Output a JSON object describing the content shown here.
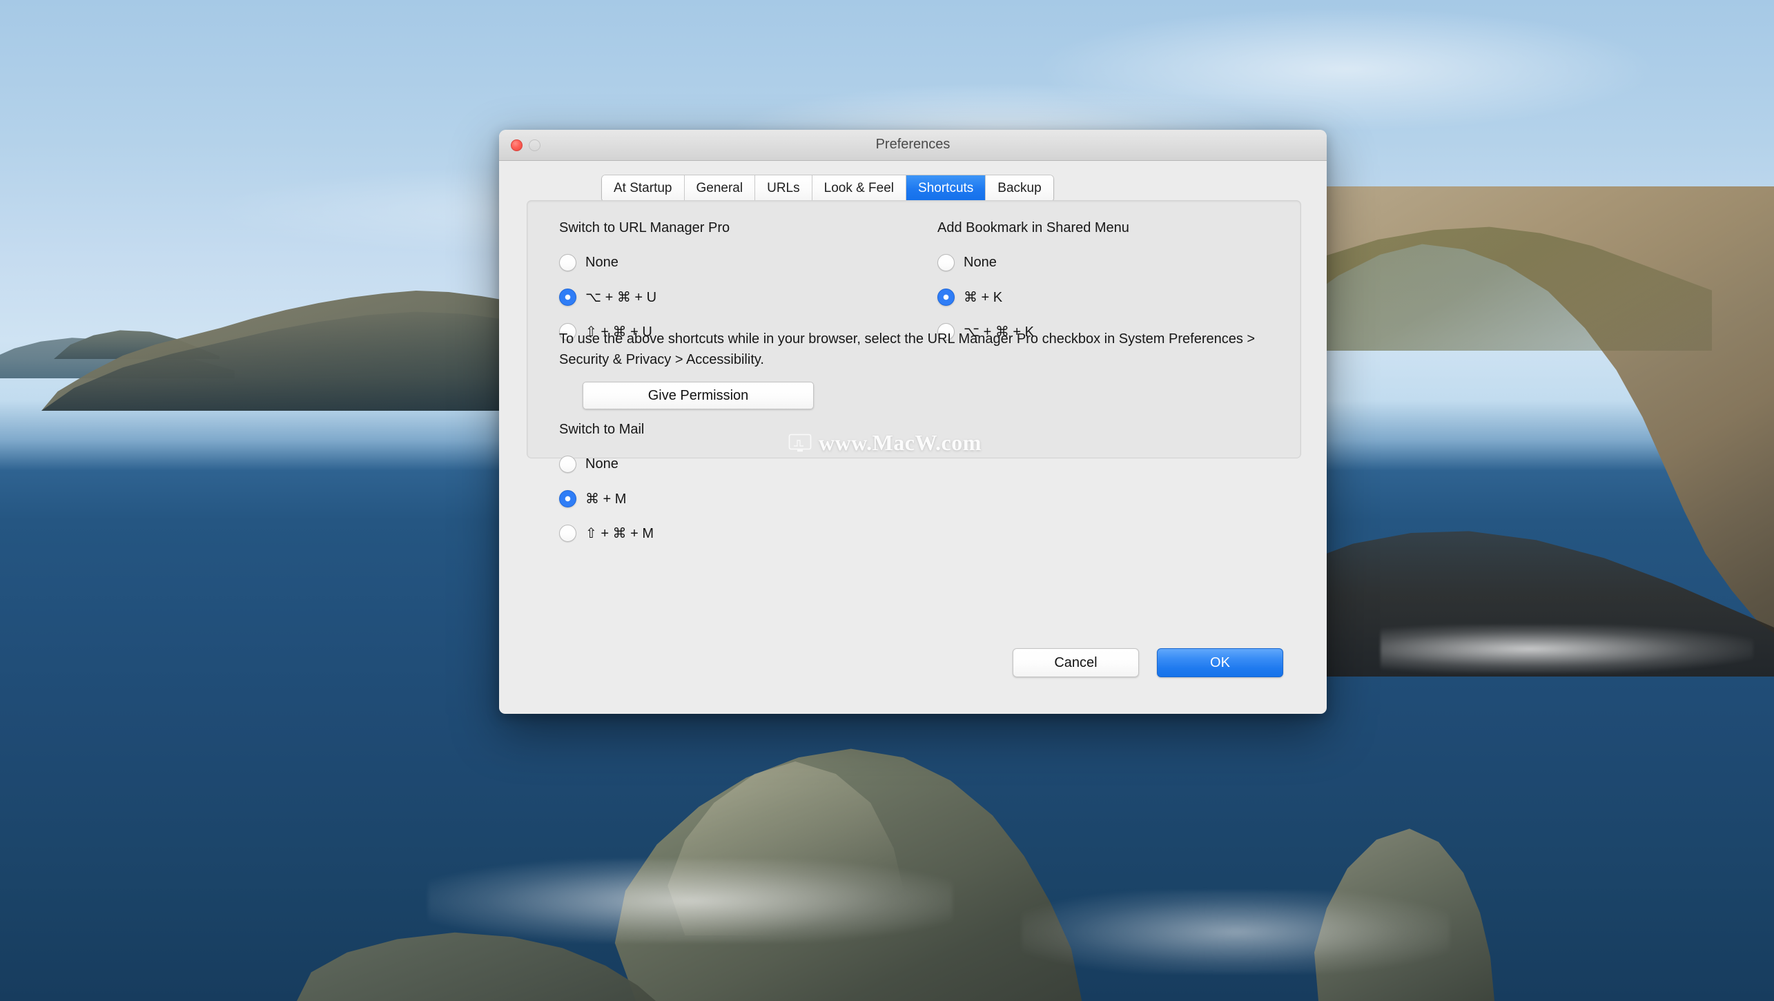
{
  "window": {
    "title": "Preferences",
    "controls": {
      "close": "close-button",
      "minimize": "minimize-button"
    }
  },
  "tabs": [
    {
      "label": "At Startup",
      "active": false
    },
    {
      "label": "General",
      "active": false
    },
    {
      "label": "URLs",
      "active": false
    },
    {
      "label": "Look & Feel",
      "active": false
    },
    {
      "label": "Shortcuts",
      "active": true
    },
    {
      "label": "Backup",
      "active": false
    }
  ],
  "groups": {
    "switch_url_manager": {
      "label": "Switch to URL Manager Pro",
      "options": [
        {
          "label": "None",
          "checked": false
        },
        {
          "label": "⌥ + ⌘ + U",
          "checked": true
        },
        {
          "label": "⇧ + ⌘ + U",
          "checked": false
        }
      ]
    },
    "add_bookmark": {
      "label": "Add Bookmark in Shared Menu",
      "options": [
        {
          "label": "None",
          "checked": false
        },
        {
          "label": "⌘ + K",
          "checked": true
        },
        {
          "label": "⌥ + ⌘ + K",
          "checked": false
        }
      ]
    },
    "switch_mail": {
      "label": "Switch to Mail",
      "options": [
        {
          "label": "None",
          "checked": false
        },
        {
          "label": "⌘ + M",
          "checked": true
        },
        {
          "label": "⇧ + ⌘ + M",
          "checked": false
        }
      ]
    }
  },
  "info_text": "To use the above shortcuts while in your browser, select the URL Manager Pro checkbox in System Preferences > Security & Privacy > Accessibility.",
  "give_permission_label": "Give Permission",
  "footer": {
    "cancel_label": "Cancel",
    "ok_label": "OK"
  },
  "watermark": {
    "text": "www.MacW.com",
    "icon": "monitor-icon"
  },
  "colors": {
    "accent_blue": "#1f7aef",
    "tab_active_blue": "#1d78f0",
    "radio_checked": "#2f7df6",
    "close_red": "#ff6259",
    "window_bg": "#ececec",
    "panel_bg": "#e6e6e6"
  }
}
